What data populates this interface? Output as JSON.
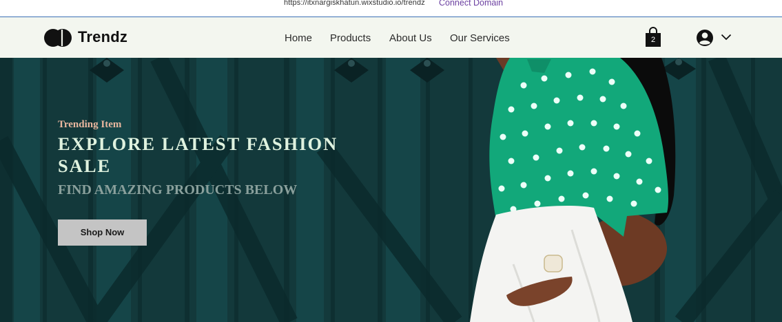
{
  "browser": {
    "url": "https://itxnargiskhatun.wixstudio.io/trendz",
    "connect_domain_label": "Connect Domain"
  },
  "header": {
    "brand": "Trendz",
    "nav": [
      {
        "label": "Home"
      },
      {
        "label": "Products"
      },
      {
        "label": "About Us"
      },
      {
        "label": "Our Services"
      }
    ],
    "cart_count": "2",
    "icons": {
      "logo": "two-circle-logo-icon",
      "cart": "shopping-bag-icon",
      "account": "user-avatar-icon",
      "account_menu": "chevron-down-icon"
    }
  },
  "hero": {
    "eyebrow": "Trending Item",
    "title": "EXPLORE LATEST FASHION SALE",
    "subtitle": "FIND AMAZING PRODUCTS BELOW",
    "cta_label": "Shop Now",
    "background_image": "woman in green polka-dot shirt and white skirt in front of dark teal wooden doors"
  },
  "colors": {
    "header_bg": "#f3f6ef",
    "hero_bg": "#12383a",
    "eyebrow": "#e9b79f",
    "title": "#dff2df",
    "subtitle": "#8aa09c",
    "button_bg": "#c4c4c4",
    "connect_link": "#6b3fa0"
  }
}
